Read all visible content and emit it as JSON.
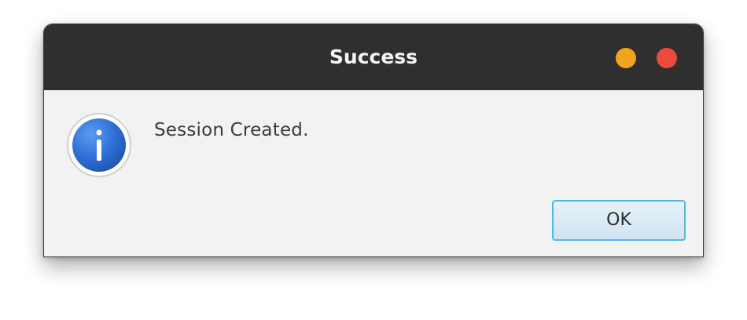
{
  "dialog": {
    "title": "Success",
    "message": "Session Created.",
    "ok_label": "OK",
    "icon": "info-icon"
  },
  "window_controls": {
    "minimize_color": "#f0a31e",
    "close_color": "#ec4a3f"
  },
  "colors": {
    "titlebar": "#2f2f2f",
    "content_bg": "#f2f2f2",
    "info_blue": "#2f6fd6",
    "ok_border": "#56b6e6"
  }
}
